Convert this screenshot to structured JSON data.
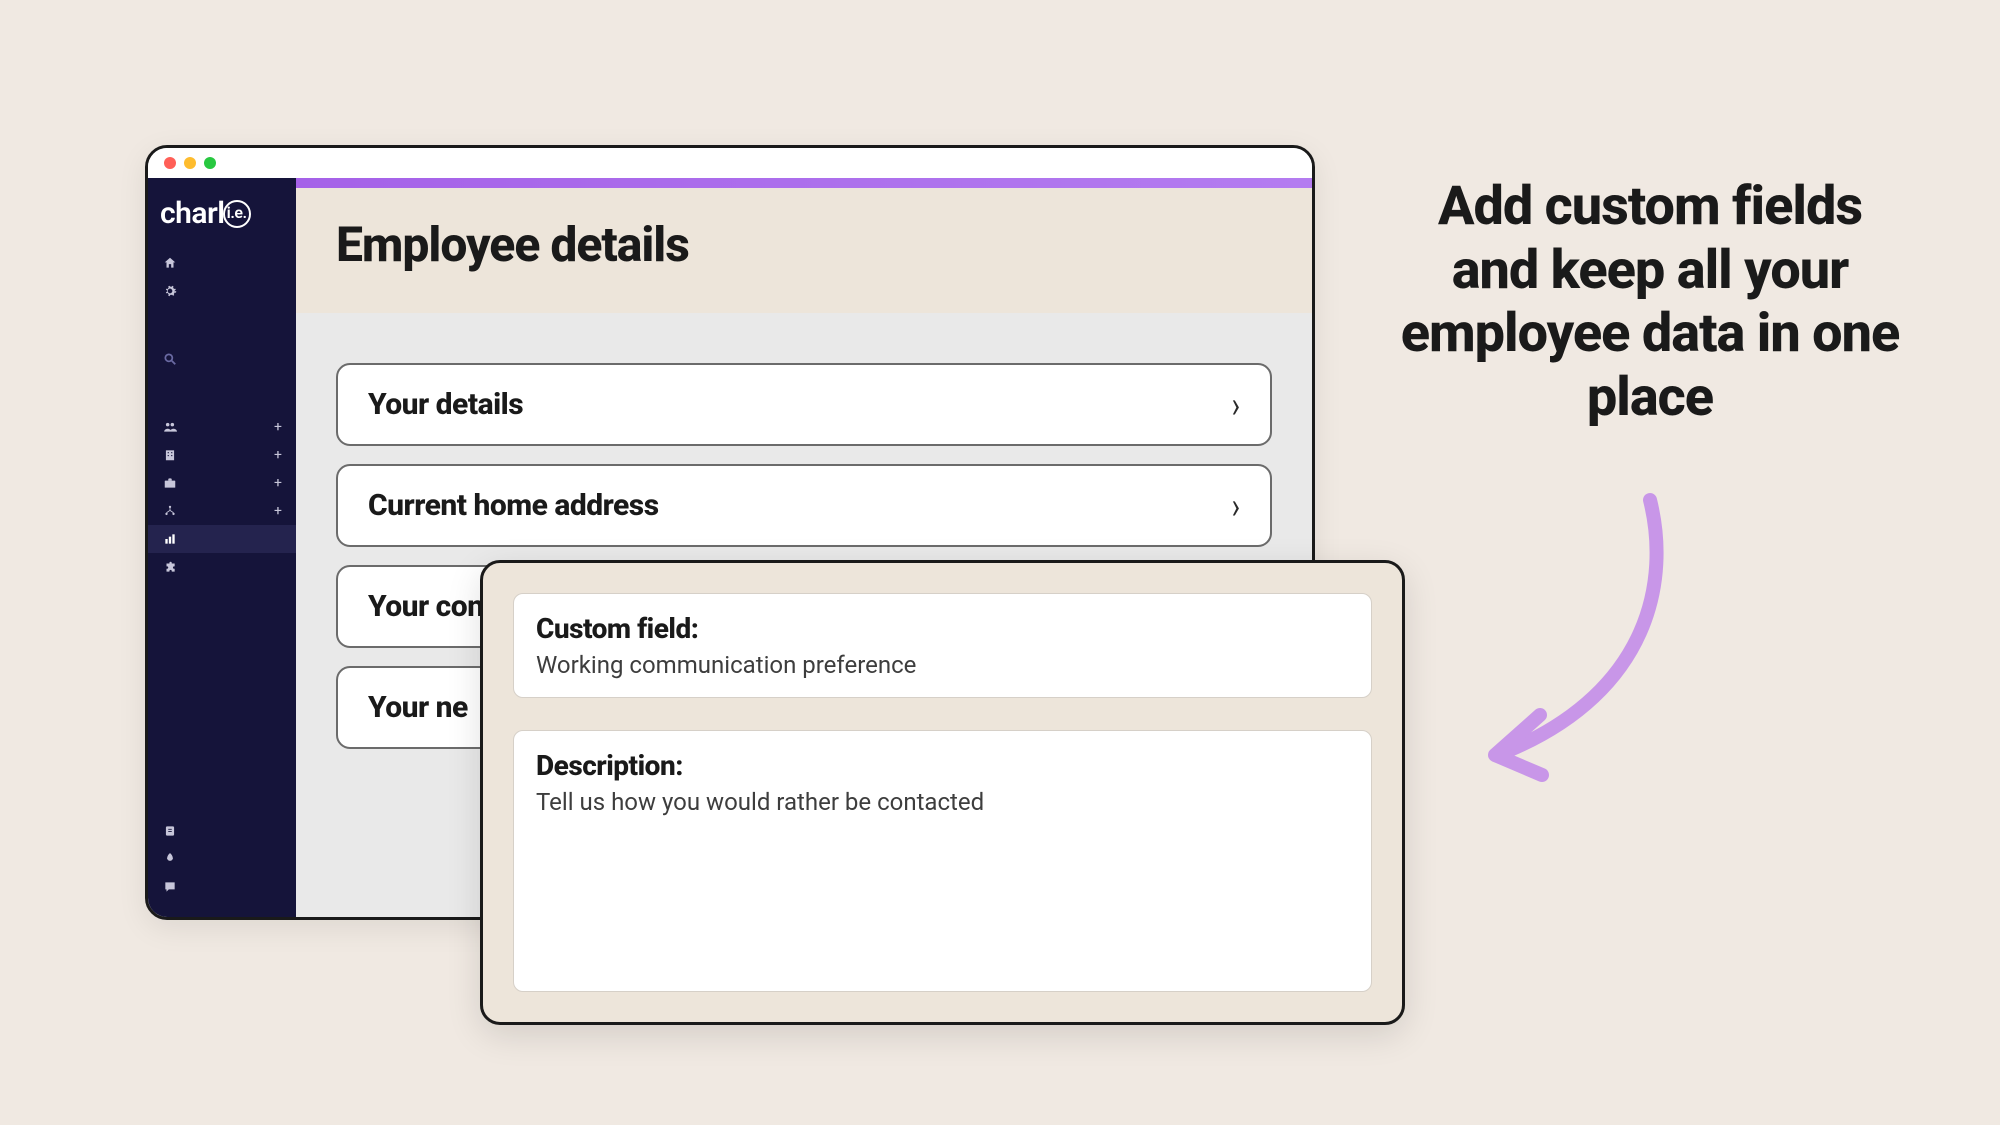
{
  "app": {
    "logo_text": "charl",
    "logo_badge": "i.e."
  },
  "page": {
    "title": "Employee details"
  },
  "accordion": {
    "items": [
      {
        "label": "Your details"
      },
      {
        "label": "Current home address"
      },
      {
        "label": "Your contact information"
      },
      {
        "label": "Your ne"
      }
    ]
  },
  "popup": {
    "field_label": "Custom field:",
    "field_value": "Working communication preference",
    "desc_label": "Description:",
    "desc_value": "Tell us how you would rather be contacted"
  },
  "marketing": {
    "headline": "Add custom fields and keep all your employee data in one place"
  },
  "sidebar": {
    "icons": [
      {
        "name": "home-icon"
      },
      {
        "name": "gear-icon"
      },
      {
        "name": "search-icon"
      },
      {
        "name": "people-icon",
        "plus": true
      },
      {
        "name": "building-icon",
        "plus": true
      },
      {
        "name": "briefcase-icon",
        "plus": true
      },
      {
        "name": "tree-icon",
        "plus": true
      },
      {
        "name": "barchart-icon",
        "active": true
      },
      {
        "name": "puzzle-icon"
      },
      {
        "name": "help-icon"
      },
      {
        "name": "rocket-icon"
      },
      {
        "name": "comment-icon"
      }
    ]
  }
}
